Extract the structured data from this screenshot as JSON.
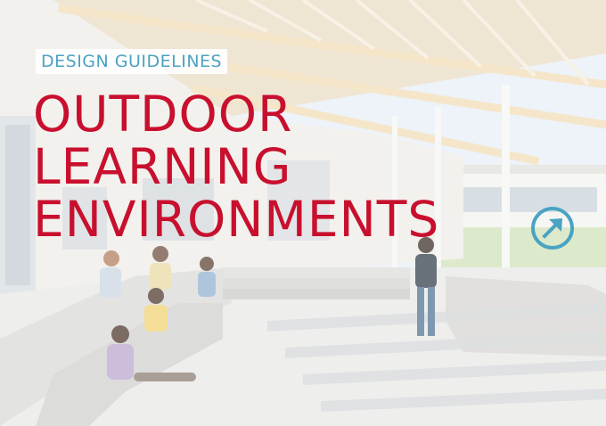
{
  "header": {
    "eyebrow": "DESIGN GUIDELINES",
    "title_lines": [
      "OUTDOOR",
      "LEARNING",
      "ENVIRONMENTS"
    ]
  },
  "icons": {
    "arrow": "arrow-up-right-circle-icon"
  },
  "colors": {
    "title": "#c8102e",
    "accent": "#4aa3c3",
    "background_wash": "#ffffff"
  }
}
